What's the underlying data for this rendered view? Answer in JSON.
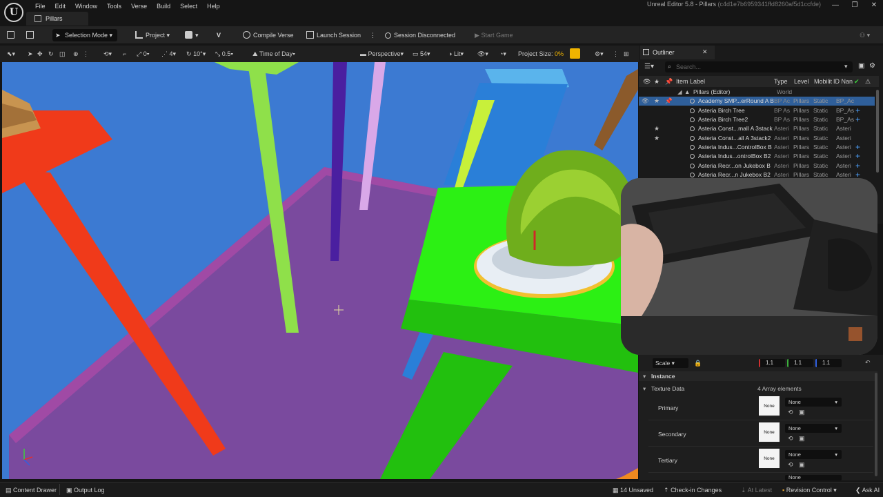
{
  "app": {
    "menu": [
      "File",
      "Edit",
      "Window",
      "Tools",
      "Verse",
      "Build",
      "Select",
      "Help"
    ],
    "level_tab": "Pillars",
    "window_title": "Unreal Editor 5.8 - Pillars",
    "window_hash": "(c4d1e7b6959341ffd8260af5d1ccfde)",
    "logo": "U"
  },
  "toolbar": {
    "mode": "Selection Mode",
    "project": "Project",
    "compile": "Compile Verse",
    "launch": "Launch Session",
    "session": "Session Disconnected",
    "start": "Start Game"
  },
  "viewport_toolbar": {
    "rotation_snap": "0",
    "grid_snap": "4",
    "angle_snap": "10°",
    "scale_snap": "0.5",
    "time_of_day": "Time of Day",
    "perspective": "Perspective",
    "fov": "54",
    "lit": "Lit",
    "project_size_label": "Project Size:",
    "project_size_value": "0%"
  },
  "outliner": {
    "title": "Outliner",
    "search_placeholder": "Search...",
    "columns": {
      "label": "Item Label",
      "type": "Type",
      "level": "Level",
      "mobility": "Mobilit",
      "id": "ID Nan"
    },
    "folder": {
      "label": "Pillars (Editor)",
      "type": "World"
    },
    "rows": [
      {
        "label": "Academy SMP...erRound A B",
        "type": "BP Ac",
        "level": "Pillars",
        "mobility": "Static",
        "id": "BP_Ac",
        "plus": "",
        "star": "★",
        "eye": "👁",
        "pin": "📌"
      },
      {
        "label": "Asteria Birch Tree",
        "type": "BP As",
        "level": "Pillars",
        "mobility": "Static",
        "id": "BP_As",
        "plus": "+",
        "star": "",
        "eye": "",
        "pin": ""
      },
      {
        "label": "Asteria Birch Tree2",
        "type": "BP As",
        "level": "Pillars",
        "mobility": "Static",
        "id": "BP_As",
        "plus": "+",
        "star": "",
        "eye": "",
        "pin": ""
      },
      {
        "label": "Asteria Const...mall A 3stack",
        "type": "Asteri",
        "level": "Pillars",
        "mobility": "Static",
        "id": "Asteri",
        "plus": "",
        "star": "★",
        "eye": "",
        "pin": ""
      },
      {
        "label": "Asteria Const...all A 3stack2",
        "type": "Asteri",
        "level": "Pillars",
        "mobility": "Static",
        "id": "Asteri",
        "plus": "",
        "star": "★",
        "eye": "",
        "pin": ""
      },
      {
        "label": "Asteria Indus...ControlBox B",
        "type": "Asteri",
        "level": "Pillars",
        "mobility": "Static",
        "id": "Asteri",
        "plus": "+",
        "star": "",
        "eye": "",
        "pin": ""
      },
      {
        "label": "Asteria Indus...ontrolBox B2",
        "type": "Asteri",
        "level": "Pillars",
        "mobility": "Static",
        "id": "Asteri",
        "plus": "+",
        "star": "",
        "eye": "",
        "pin": ""
      },
      {
        "label": "Asteria Recr...on Jukebox B",
        "type": "Asteri",
        "level": "Pillars",
        "mobility": "Static",
        "id": "Asteri",
        "plus": "+",
        "star": "",
        "eye": "",
        "pin": ""
      },
      {
        "label": "Asteria Recr...n Jukebox B2",
        "type": "Asteri",
        "level": "Pillars",
        "mobility": "Static",
        "id": "Asteri",
        "plus": "+",
        "star": "",
        "eye": "",
        "pin": ""
      }
    ]
  },
  "details": {
    "scale_label": "Scale",
    "scale_x": "1.1",
    "scale_y": "1.1",
    "scale_z": "1.1",
    "instance_section": "Instance",
    "texture_data": "Texture Data",
    "array_count": "4 Array elements",
    "slots": [
      {
        "name": "Primary",
        "swatch": "None",
        "value": "None"
      },
      {
        "name": "Secondary",
        "swatch": "None",
        "value": "None"
      },
      {
        "name": "Tertiary",
        "swatch": "None",
        "value": "None"
      }
    ],
    "partial_value": "None"
  },
  "statusbar": {
    "content_drawer": "Content Drawer",
    "output_log": "Output Log",
    "unsaved": "14 Unsaved",
    "checkin": "Check-in Changes",
    "latest": "At Latest",
    "revision": "Revision Control",
    "ask_ai": "Ask AI"
  },
  "colors": {
    "accent_selection": "#2f5f9a",
    "viewport_sky": "#3c7ad2",
    "project_size_accent": "#f0b400"
  }
}
